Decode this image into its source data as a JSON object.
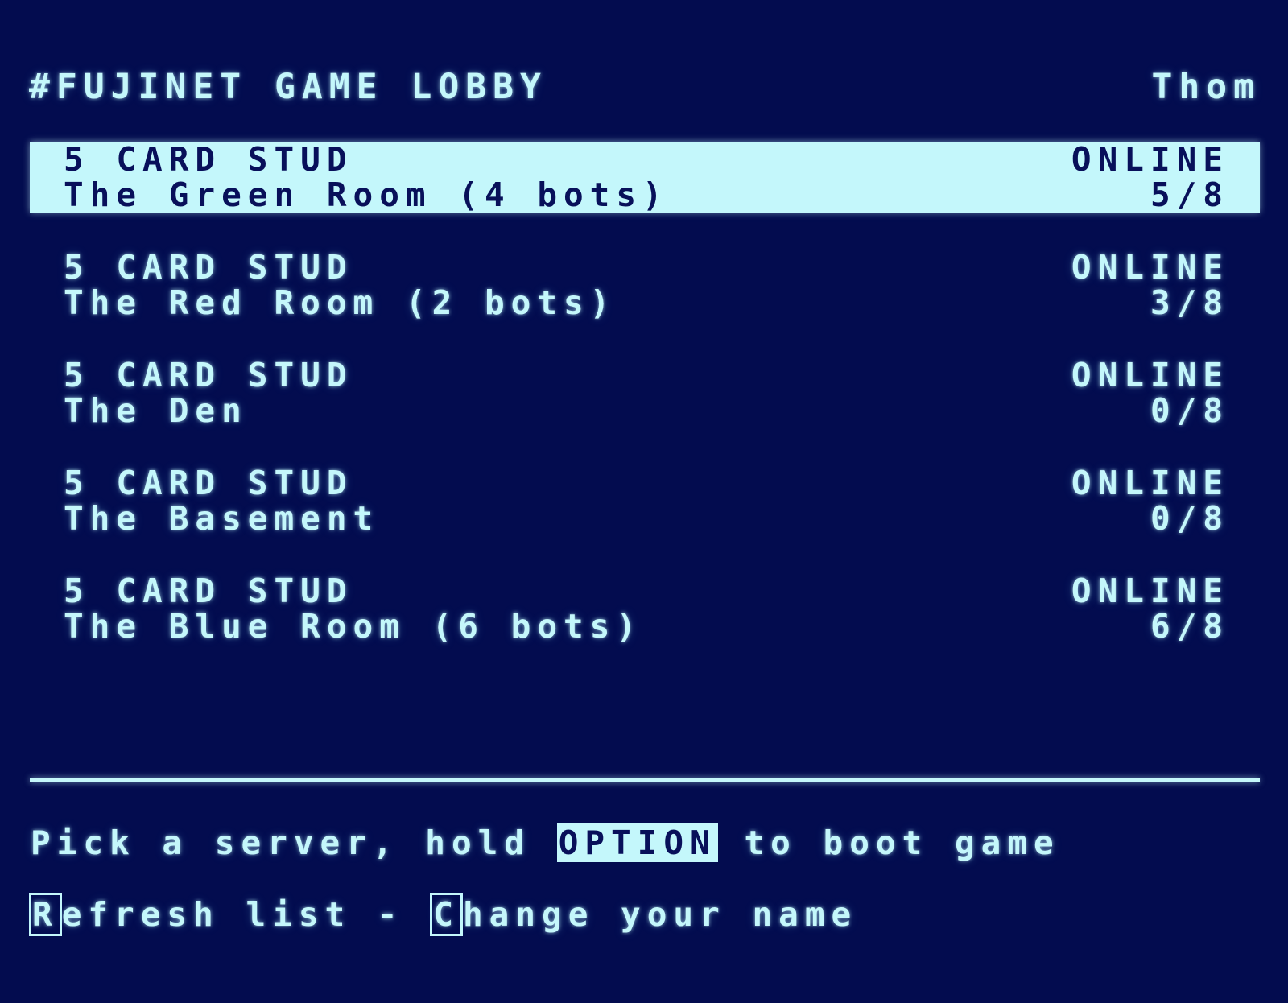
{
  "header": {
    "title": "#FUJINET GAME LOBBY",
    "user": "Thom"
  },
  "servers": [
    {
      "game": "5 CARD STUD",
      "status": "ONLINE",
      "name": "The Green Room (4 bots)",
      "players": "5/8"
    },
    {
      "game": "5 CARD STUD",
      "status": "ONLINE",
      "name": "The Red Room (2 bots)",
      "players": "3/8"
    },
    {
      "game": "5 CARD STUD",
      "status": "ONLINE",
      "name": "The Den",
      "players": "0/8"
    },
    {
      "game": "5 CARD STUD",
      "status": "ONLINE",
      "name": "The Basement",
      "players": "0/8"
    },
    {
      "game": "5 CARD STUD",
      "status": "ONLINE",
      "name": "The Blue Room (6 bots)",
      "players": "6/8"
    }
  ],
  "instructions": {
    "prefix": "Pick a server, hold ",
    "option_key": "OPTION",
    "suffix": " to boot game"
  },
  "help": {
    "refresh_key": "R",
    "refresh_label": "efresh list - ",
    "change_key": "C",
    "change_label": "hange your name"
  },
  "colors": {
    "background": "#030c4f",
    "text": "#c4f7fb",
    "inverse_text": "#08105a"
  }
}
